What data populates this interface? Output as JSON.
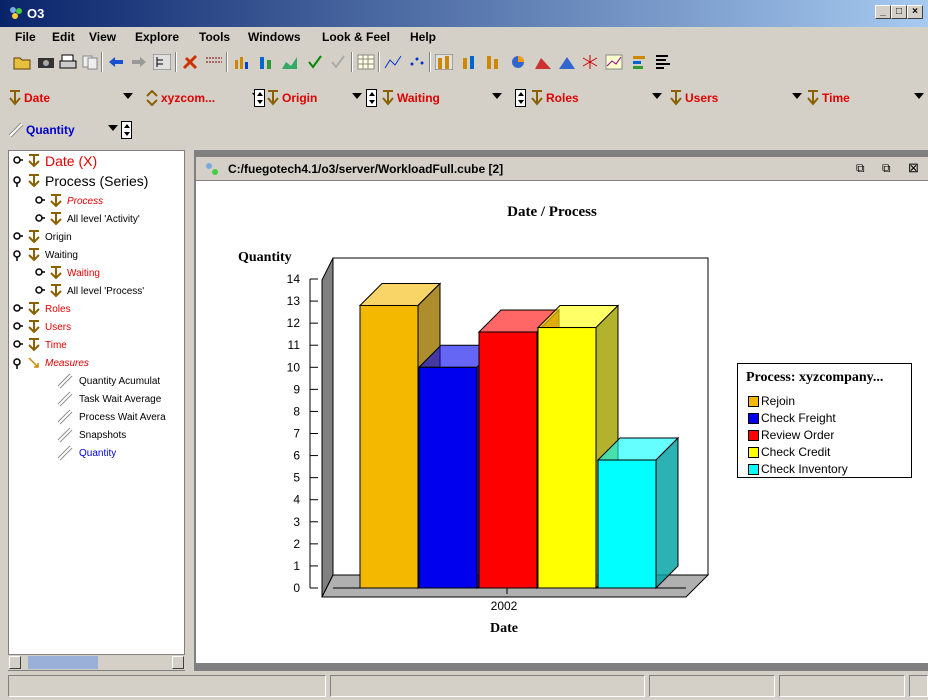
{
  "window": {
    "title": "O3"
  },
  "menu": {
    "items": [
      "File",
      "Edit",
      "View",
      "Explore",
      "Tools",
      "Windows",
      "Look & Feel",
      "Help"
    ]
  },
  "dimensions": {
    "row1": [
      {
        "label": "Date",
        "color": "#e00000"
      },
      {
        "label": "xyzcom...",
        "color": "#e00000"
      },
      {
        "label": "Origin",
        "color": "#e00000"
      },
      {
        "label": "Waiting",
        "color": "#e00000"
      },
      {
        "label": "Roles",
        "color": "#e00000"
      },
      {
        "label": "Users",
        "color": "#e00000"
      },
      {
        "label": "Time",
        "color": "#e00000"
      }
    ],
    "row2": [
      {
        "label": "Quantity",
        "color": "#0000cc"
      }
    ]
  },
  "tree": {
    "items": [
      {
        "label": "Date (X)",
        "color": "#e00000",
        "italic": false,
        "size": "large"
      },
      {
        "label": "Process (Series)",
        "color": "#000000",
        "italic": false,
        "size": "large"
      },
      {
        "label": "Process",
        "color": "#e00000",
        "italic": true,
        "size": "small"
      },
      {
        "label": "All level 'Activity'",
        "color": "#000000",
        "italic": false,
        "size": "small"
      },
      {
        "label": "Origin",
        "color": "#000000",
        "italic": false,
        "size": "small"
      },
      {
        "label": "Waiting",
        "color": "#000000",
        "italic": false,
        "size": "small"
      },
      {
        "label": "Waiting",
        "color": "#e00000",
        "italic": false,
        "size": "small"
      },
      {
        "label": "All level 'Process'",
        "color": "#000000",
        "italic": false,
        "size": "small"
      },
      {
        "label": "Roles",
        "color": "#e00000",
        "italic": false,
        "size": "small"
      },
      {
        "label": "Users",
        "color": "#e00000",
        "italic": false,
        "size": "small"
      },
      {
        "label": "Time",
        "color": "#e00000",
        "italic": false,
        "size": "small"
      },
      {
        "label": "Measures",
        "color": "#e00000",
        "italic": true,
        "size": "small"
      },
      {
        "label": "Quantity Acumulat",
        "color": "#000000",
        "italic": false,
        "size": "small"
      },
      {
        "label": "Task Wait Average",
        "color": "#000000",
        "italic": false,
        "size": "small"
      },
      {
        "label": "Process Wait Avera",
        "color": "#000000",
        "italic": false,
        "size": "small"
      },
      {
        "label": "Snapshots",
        "color": "#000000",
        "italic": false,
        "size": "small"
      },
      {
        "label": "Quantity",
        "color": "#0000cc",
        "italic": false,
        "size": "small"
      }
    ]
  },
  "inner_window": {
    "title": "C:/fuegotech4.1/o3/server/WorkloadFull.cube [2]"
  },
  "chart_data": {
    "type": "bar",
    "title": "Date / Process",
    "xlabel": "Date",
    "ylabel": "Quantity",
    "categories": [
      "2002"
    ],
    "ylim": [
      0,
      14
    ],
    "yticks": [
      0,
      1,
      2,
      3,
      4,
      5,
      6,
      7,
      8,
      9,
      10,
      11,
      12,
      13,
      14
    ],
    "legend_title": "Process: xyzcompany...",
    "legend_placement": "right",
    "series": [
      {
        "name": "Rejoin",
        "values": [
          12.8
        ],
        "color": "#f5b800"
      },
      {
        "name": "Check Freight",
        "values": [
          10.0
        ],
        "color": "#0000ee"
      },
      {
        "name": "Review Order",
        "values": [
          11.6
        ],
        "color": "#ff0000"
      },
      {
        "name": "Check Credit",
        "values": [
          11.8
        ],
        "color": "#ffff00"
      },
      {
        "name": "Check Inventory",
        "values": [
          5.8
        ],
        "color": "#00ffff"
      }
    ]
  }
}
